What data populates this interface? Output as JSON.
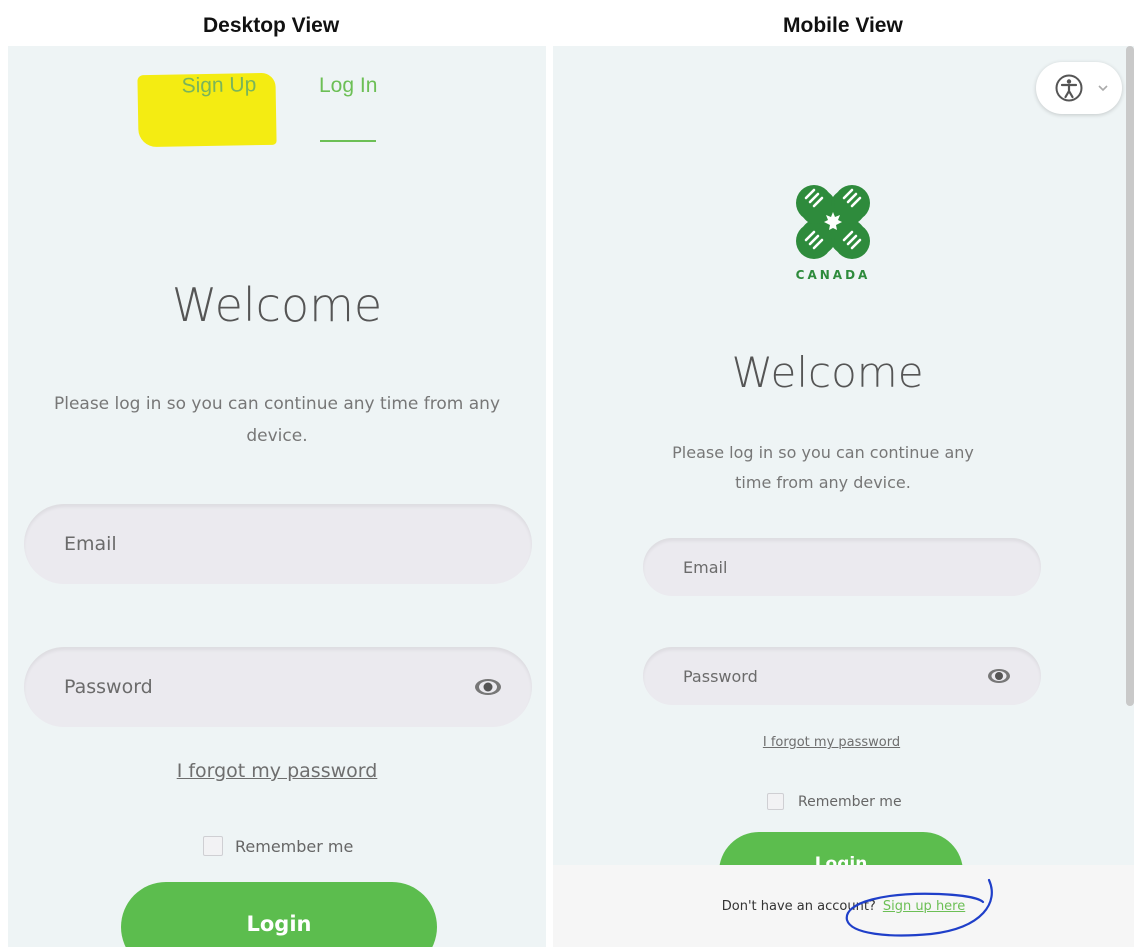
{
  "headings": {
    "desktop": "Desktop View",
    "mobile": "Mobile View"
  },
  "desktop": {
    "tabs": {
      "signup": "Sign Up",
      "login": "Log In"
    },
    "title": "Welcome",
    "subtitle_line1": "Please log in so you can continue any time from any",
    "subtitle_line2": "device.",
    "email_placeholder": "Email",
    "password_placeholder": "Password",
    "forgot": "I forgot my password",
    "remember": "Remember me",
    "login_button": "Login"
  },
  "mobile": {
    "logo_text": "CANADA",
    "title": "Welcome",
    "subtitle_line1": "Please log in so you can continue any",
    "subtitle_line2": "time from any device.",
    "email_placeholder": "Email",
    "password_placeholder": "Password",
    "forgot": "I forgot my password",
    "remember": "Remember me",
    "login_button": "Login",
    "footer_text": "Don't have an account?",
    "footer_link": "Sign up here"
  },
  "colors": {
    "brand_green": "#5cbd4e",
    "highlight": "#f4ec12",
    "annotation": "#1f3fc9",
    "panel_bg": "#eef4f5"
  },
  "icons": [
    "eye-icon",
    "accessibility-icon",
    "chevron-down-icon",
    "four-h-clover-logo"
  ]
}
